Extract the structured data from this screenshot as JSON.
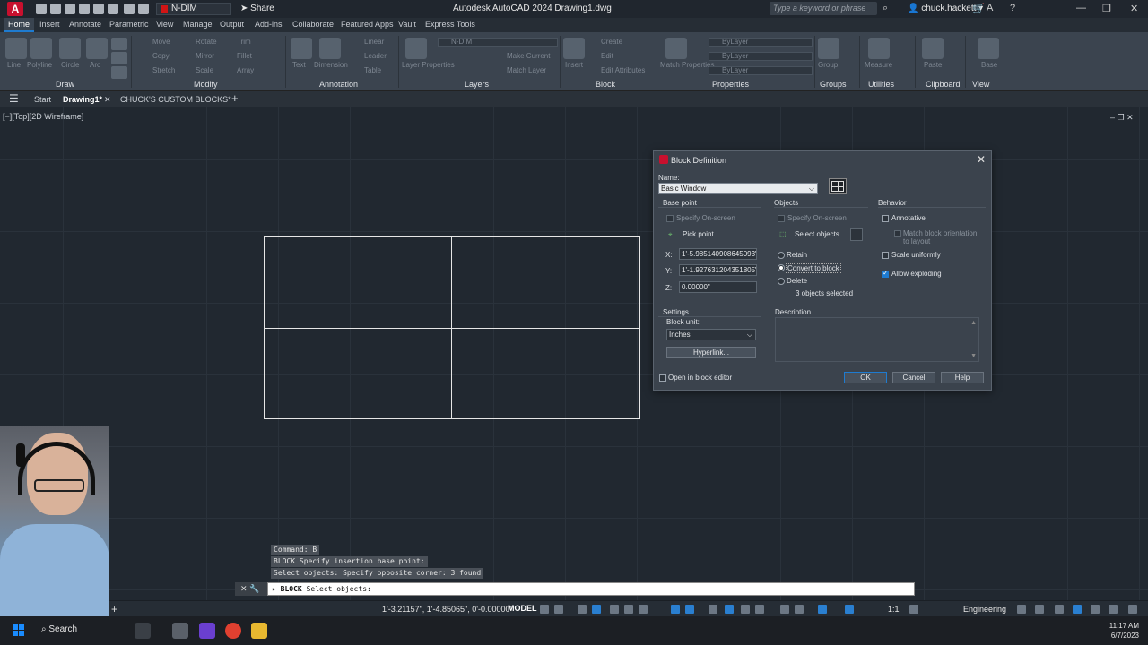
{
  "titlebar": {
    "logo": "A",
    "layer": "N-DIM",
    "share": "Share",
    "app_title": "Autodesk AutoCAD 2024    Drawing1.dwg",
    "search_placeholder": "Type a keyword or phrase",
    "user": "chuck.hackett"
  },
  "ribbon_tabs": [
    "Home",
    "Insert",
    "Annotate",
    "Parametric",
    "View",
    "Manage",
    "Output",
    "Add-ins",
    "Collaborate",
    "Featured Apps",
    "Vault",
    "Express Tools"
  ],
  "ribbon": {
    "draw_items": [
      "Line",
      "Polyline",
      "Circle",
      "Arc"
    ],
    "modify_items": [
      "Move",
      "Rotate",
      "Trim",
      "Copy",
      "Mirror",
      "Fillet",
      "Stretch",
      "Scale",
      "Array"
    ],
    "annotation_items": [
      "Text",
      "Dimension",
      "Linear",
      "Leader",
      "Table"
    ],
    "layers_items": [
      "Layer Properties",
      "Make Current",
      "Match Layer"
    ],
    "layer_combo": "N-DIM",
    "block_items": [
      "Insert",
      "Create",
      "Edit",
      "Edit Attributes"
    ],
    "properties_items": [
      "Match Properties"
    ],
    "bylayer": "ByLayer",
    "groups_items": [
      "Group"
    ],
    "utilities_items": [
      "Measure"
    ],
    "clipboard_items": [
      "Paste"
    ],
    "view_items": [
      "Base"
    ],
    "panel_labels": [
      "Draw",
      "Modify",
      "Annotation",
      "Layers",
      "Block",
      "Properties",
      "Groups",
      "Utilities",
      "Clipboard",
      "View"
    ]
  },
  "doc_tabs": {
    "start": "Start",
    "drawing": "Drawing1*",
    "custom": "CHUCK'S CUSTOM BLOCKS*"
  },
  "viewport_label": "[−][Top][2D Wireframe]",
  "dialog": {
    "title": "Block Definition",
    "name_label": "Name:",
    "name_value": "Basic Window",
    "base_point": {
      "heading": "Base point",
      "specify": "Specify On-screen",
      "pick": "Pick point",
      "x_label": "X:",
      "x_value": "1'-5.985140908645093\"",
      "y_label": "Y:",
      "y_value": "1'-1.927631204351805\"",
      "z_label": "Z:",
      "z_value": "0.00000\""
    },
    "objects": {
      "heading": "Objects",
      "specify": "Specify On-screen",
      "select": "Select objects",
      "retain": "Retain",
      "convert": "Convert to block",
      "delete": "Delete",
      "count": "3 objects selected"
    },
    "behavior": {
      "heading": "Behavior",
      "annotative": "Annotative",
      "match": "Match block orientation to layout",
      "scale": "Scale uniformly",
      "explode": "Allow exploding"
    },
    "settings": {
      "heading": "Settings",
      "unit_label": "Block unit:",
      "unit_value": "Inches",
      "hyperlink": "Hyperlink..."
    },
    "description_label": "Description",
    "open_editor": "Open in block editor",
    "ok": "OK",
    "cancel": "Cancel",
    "help": "Help"
  },
  "command": {
    "history": [
      "Command: B",
      "BLOCK Specify insertion base point:",
      "Select objects: Specify opposite corner: 3 found"
    ],
    "prompt_cmd": "BLOCK",
    "prompt_text": "Select objects:"
  },
  "statusbar": {
    "coords": "1'-3.21157\", 1'-4.85065\", 0'-0.00000\"",
    "model": "MODEL",
    "scale": "1:1",
    "workspace": "Engineering"
  },
  "taskbar": {
    "search": "Search",
    "time": "11:17 AM",
    "date": "6/7/2023"
  }
}
